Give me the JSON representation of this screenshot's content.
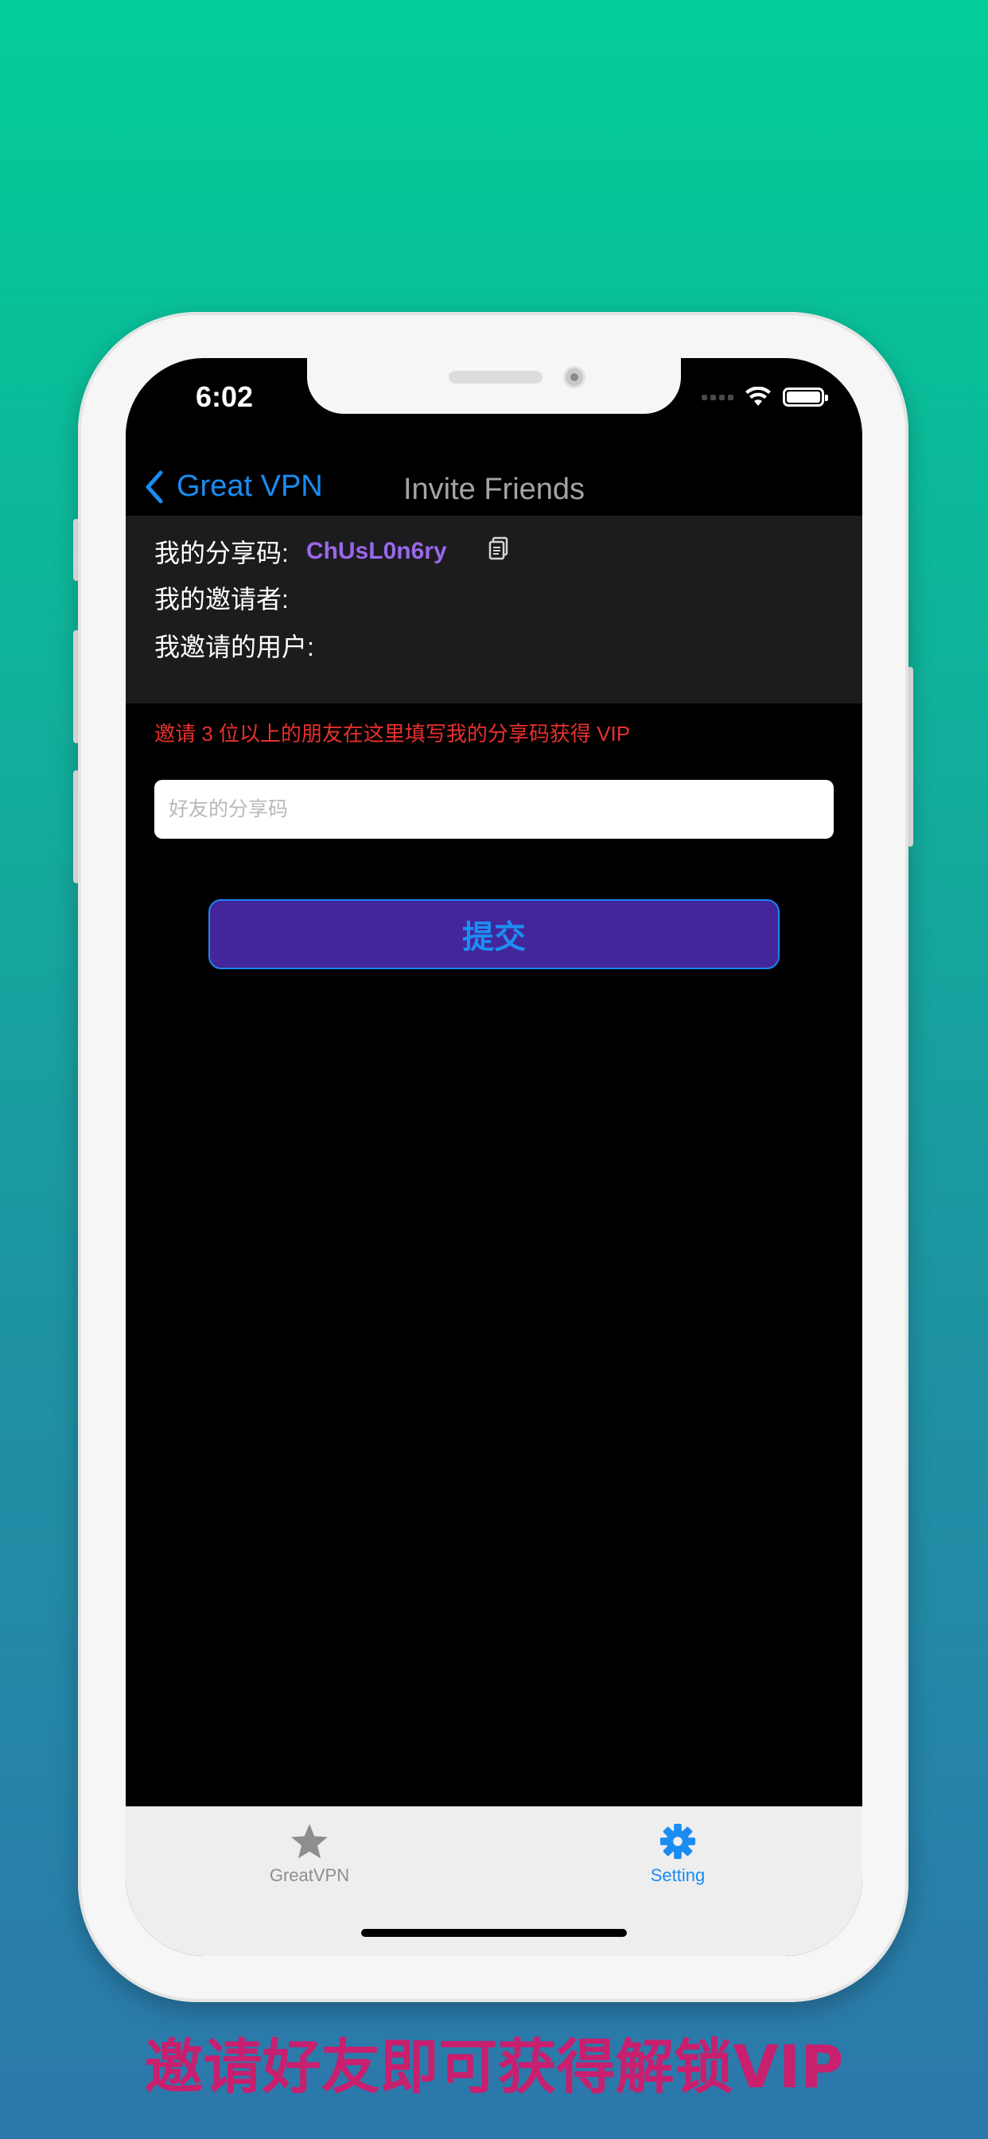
{
  "status_bar": {
    "time": "6:02"
  },
  "nav": {
    "back_label": "Great VPN",
    "title": "Invite Friends"
  },
  "info": {
    "share_code_label": "我的分享码:",
    "share_code_value": "ChUsL0n6ry",
    "inviter_label": "我的邀请者:",
    "invited_users_label": "我邀请的用户:"
  },
  "hint": "邀请 3 位以上的朋友在这里填写我的分享码获得 VIP",
  "friend_code_input": {
    "placeholder": "好友的分享码",
    "value": ""
  },
  "submit_label": "提交",
  "tabs": [
    {
      "label": "GreatVPN",
      "icon": "star-icon",
      "selected": false,
      "color": "#8e8e8e"
    },
    {
      "label": "Setting",
      "icon": "gear-icon",
      "selected": true,
      "color": "#1a8cf2"
    }
  ],
  "promo_text": "邀请好友即可获得解锁VIP",
  "colors": {
    "accent": "#1a8cf2",
    "share_code": "#9a68ea",
    "hint": "#e8302e",
    "submit_bg": "#42269a",
    "promo": "#c81f6e"
  }
}
